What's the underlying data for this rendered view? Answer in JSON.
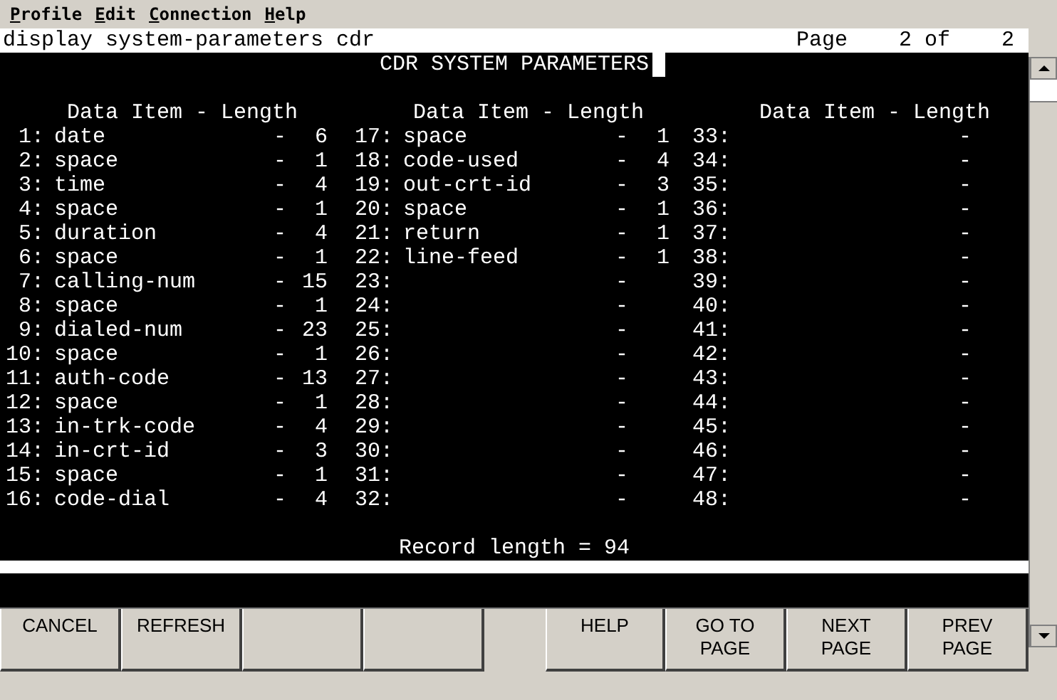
{
  "menu": [
    "Profile",
    "Edit",
    "Connection",
    "Help"
  ],
  "command": "display system-parameters cdr",
  "page_indicator": "Page    2 of    2",
  "form_title": "CDR SYSTEM PARAMETERS",
  "column_headers": [
    "Data Item - Length",
    "Data Item - Length",
    "Data Item - Length"
  ],
  "columns": [
    [
      {
        "number": "1:",
        "item": "date",
        "dash": "-",
        "length": "6"
      },
      {
        "number": "2:",
        "item": "space",
        "dash": "-",
        "length": "1"
      },
      {
        "number": "3:",
        "item": "time",
        "dash": "-",
        "length": "4"
      },
      {
        "number": "4:",
        "item": "space",
        "dash": "-",
        "length": "1"
      },
      {
        "number": "5:",
        "item": "duration",
        "dash": "-",
        "length": "4"
      },
      {
        "number": "6:",
        "item": "space",
        "dash": "-",
        "length": "1"
      },
      {
        "number": "7:",
        "item": "calling-num",
        "dash": "-",
        "length": "15"
      },
      {
        "number": "8:",
        "item": "space",
        "dash": "-",
        "length": "1"
      },
      {
        "number": "9:",
        "item": "dialed-num",
        "dash": "-",
        "length": "23"
      },
      {
        "number": "10:",
        "item": "space",
        "dash": "-",
        "length": "1"
      },
      {
        "number": "11:",
        "item": "auth-code",
        "dash": "-",
        "length": "13"
      },
      {
        "number": "12:",
        "item": "space",
        "dash": "-",
        "length": "1"
      },
      {
        "number": "13:",
        "item": "in-trk-code",
        "dash": "-",
        "length": "4"
      },
      {
        "number": "14:",
        "item": "in-crt-id",
        "dash": "-",
        "length": "3"
      },
      {
        "number": "15:",
        "item": "space",
        "dash": "-",
        "length": "1"
      },
      {
        "number": "16:",
        "item": "code-dial",
        "dash": "-",
        "length": "4"
      }
    ],
    [
      {
        "number": "17:",
        "item": "space",
        "dash": "-",
        "length": "1"
      },
      {
        "number": "18:",
        "item": "code-used",
        "dash": "-",
        "length": "4"
      },
      {
        "number": "19:",
        "item": "out-crt-id",
        "dash": "-",
        "length": "3"
      },
      {
        "number": "20:",
        "item": "space",
        "dash": "-",
        "length": "1"
      },
      {
        "number": "21:",
        "item": "return",
        "dash": "-",
        "length": "1"
      },
      {
        "number": "22:",
        "item": "line-feed",
        "dash": "-",
        "length": "1"
      },
      {
        "number": "23:",
        "dash": "-"
      },
      {
        "number": "24:",
        "dash": "-"
      },
      {
        "number": "25:",
        "dash": "-"
      },
      {
        "number": "26:",
        "dash": "-"
      },
      {
        "number": "27:",
        "dash": "-"
      },
      {
        "number": "28:",
        "dash": "-"
      },
      {
        "number": "29:",
        "dash": "-"
      },
      {
        "number": "30:",
        "dash": "-"
      },
      {
        "number": "31:",
        "dash": "-"
      },
      {
        "number": "32:",
        "dash": "-"
      }
    ],
    [
      {
        "number": "33:",
        "dash": "-"
      },
      {
        "number": "34:",
        "dash": "-"
      },
      {
        "number": "35:",
        "dash": "-"
      },
      {
        "number": "36:",
        "dash": "-"
      },
      {
        "number": "37:",
        "dash": "-"
      },
      {
        "number": "38:",
        "dash": "-"
      },
      {
        "number": "39:",
        "dash": "-"
      },
      {
        "number": "40:",
        "dash": "-"
      },
      {
        "number": "41:",
        "dash": "-"
      },
      {
        "number": "42:",
        "dash": "-"
      },
      {
        "number": "43:",
        "dash": "-"
      },
      {
        "number": "44:",
        "dash": "-"
      },
      {
        "number": "45:",
        "dash": "-"
      },
      {
        "number": "46:",
        "dash": "-"
      },
      {
        "number": "47:",
        "dash": "-"
      },
      {
        "number": "48:",
        "dash": "-"
      }
    ]
  ],
  "record_length": "Record length = 94",
  "buttons": [
    {
      "kind": "button",
      "label": "CANCEL"
    },
    {
      "kind": "button",
      "label": "REFRESH"
    },
    {
      "kind": "blank"
    },
    {
      "kind": "blank"
    },
    {
      "kind": "spacer"
    },
    {
      "kind": "button",
      "label": "HELP"
    },
    {
      "kind": "button",
      "label": "GO TO PAGE"
    },
    {
      "kind": "button",
      "label": "NEXT PAGE"
    },
    {
      "kind": "button",
      "label": "PREV PAGE"
    }
  ]
}
